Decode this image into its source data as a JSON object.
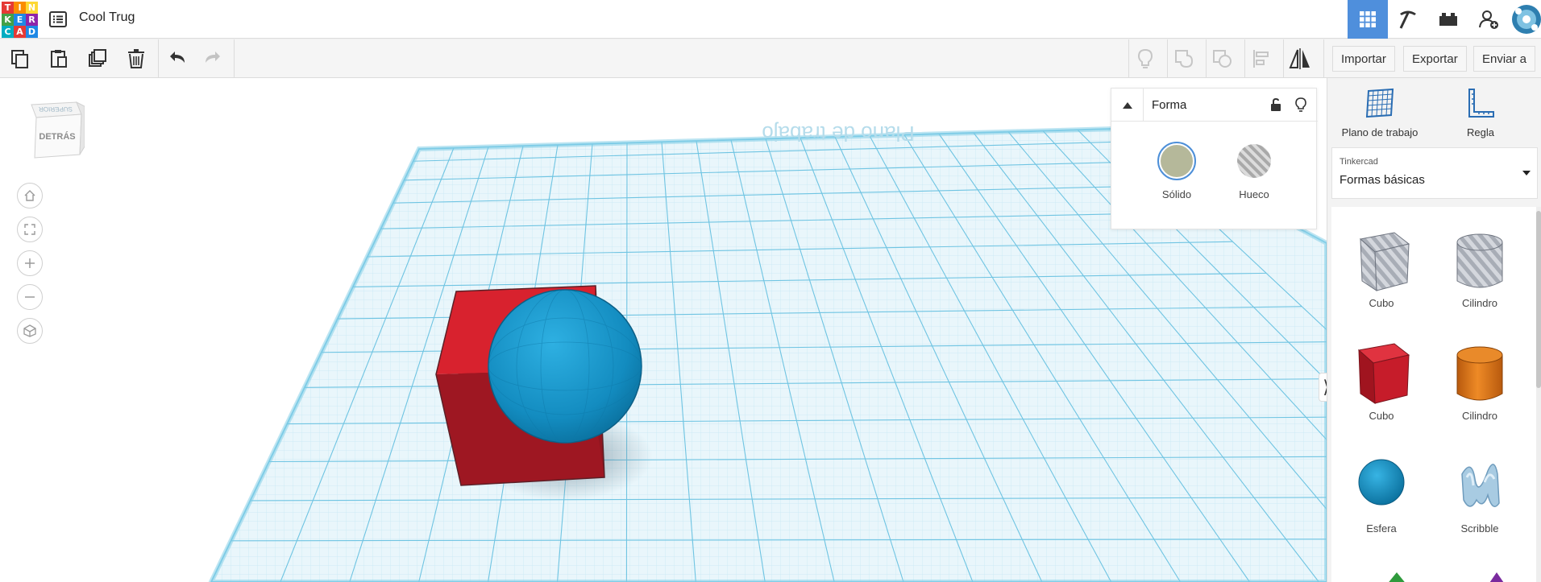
{
  "header": {
    "logo_letters": [
      "T",
      "I",
      "N",
      "K",
      "E",
      "R",
      "C",
      "A",
      "D"
    ],
    "logo_colors": [
      "#e53935",
      "#fb8c00",
      "#fdd835",
      "#43a047",
      "#1e88e5",
      "#8e24aa",
      "#00acc1",
      "#e53935",
      "#1e88e5"
    ],
    "title": "Cool Trug",
    "icons": [
      "grid-view-icon",
      "pickaxe-icon",
      "brick-icon",
      "add-user-icon",
      "avatar"
    ]
  },
  "toolbar": {
    "left_icons": [
      "copy-icon",
      "paste-icon",
      "duplicate-icon",
      "delete-icon",
      "undo-icon",
      "redo-icon"
    ],
    "right_icons": [
      "light-icon",
      "group-icon",
      "ungroup-icon",
      "align-icon",
      "mirror-icon"
    ],
    "import_label": "Importar",
    "export_label": "Exportar",
    "send_label": "Enviar a"
  },
  "viewcube": {
    "top_label": "SUPERIOR",
    "front_label": "DETRÁS"
  },
  "workplane": {
    "label": "Plano de trabajo",
    "color": "#8fd3ea"
  },
  "inspector": {
    "title": "Forma",
    "solid_label": "Sólido",
    "hole_label": "Hueco",
    "solid_color": "#b5b89a"
  },
  "right_panel": {
    "workplane_tool": "Plano de trabajo",
    "ruler_tool": "Regla",
    "library_caption": "Tinkercad",
    "library_value": "Formas básicas",
    "shapes": [
      {
        "label": "Cubo",
        "kind": "hole-box"
      },
      {
        "label": "Cilindro",
        "kind": "hole-cylinder"
      },
      {
        "label": "Cubo",
        "kind": "box",
        "color": "#d8222e"
      },
      {
        "label": "Cilindro",
        "kind": "cylinder",
        "color": "#e57c1a"
      },
      {
        "label": "Esfera",
        "kind": "sphere",
        "color": "#1a92c8"
      },
      {
        "label": "Scribble",
        "kind": "scribble",
        "color": "#9fc4dd"
      }
    ]
  },
  "scene_objects": [
    {
      "name": "Cubo",
      "color": "#d8222e"
    },
    {
      "name": "Esfera",
      "color": "#1a92c8"
    }
  ]
}
